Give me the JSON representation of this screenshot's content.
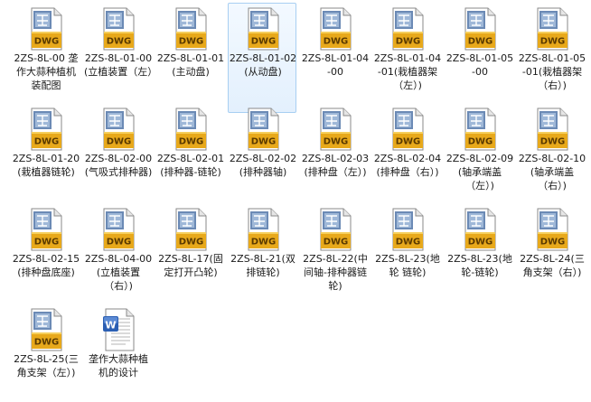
{
  "files": [
    {
      "label": "2ZS-8L-00 垄作大蒜种植机装配图",
      "type": "dwg"
    },
    {
      "label": "2ZS-8L-01-00(立植装置（左）",
      "type": "dwg"
    },
    {
      "label": "2ZS-8L-01-01(主动盘)",
      "type": "dwg"
    },
    {
      "label": "2ZS-8L-01-02(从动盘)",
      "type": "dwg",
      "selected": true
    },
    {
      "label": "2ZS-8L-01-04-00",
      "type": "dwg"
    },
    {
      "label": "2ZS-8L-01-04-01(栽植器架（左）)",
      "type": "dwg"
    },
    {
      "label": "2ZS-8L-01-05-00",
      "type": "dwg"
    },
    {
      "label": "2ZS-8L-01-05-01(栽植器架（右）)",
      "type": "dwg"
    },
    {
      "label": "2ZS-8L-01-20(栽植器链轮)",
      "type": "dwg"
    },
    {
      "label": "2ZS-8L-02-00(气吸式排种器)",
      "type": "dwg"
    },
    {
      "label": "2ZS-8L-02-01(排种器-链轮)",
      "type": "dwg"
    },
    {
      "label": "2ZS-8L-02-02(排种器轴)",
      "type": "dwg"
    },
    {
      "label": "2ZS-8L-02-03(排种盘（左）)",
      "type": "dwg"
    },
    {
      "label": "2ZS-8L-02-04(排种盘（右）)",
      "type": "dwg"
    },
    {
      "label": "2ZS-8L-02-09(轴承端盖（左）)",
      "type": "dwg"
    },
    {
      "label": "2ZS-8L-02-10(轴承端盖（右）)",
      "type": "dwg"
    },
    {
      "label": "2ZS-8L-02-15(排种盘底座)",
      "type": "dwg"
    },
    {
      "label": "2ZS-8L-04-00(立植装置（右）)",
      "type": "dwg"
    },
    {
      "label": "2ZS-8L-17(固定打开凸轮)",
      "type": "dwg"
    },
    {
      "label": "2ZS-8L-21(双排链轮)",
      "type": "dwg"
    },
    {
      "label": "2ZS-8L-22(中间轴-排种器链轮)",
      "type": "dwg"
    },
    {
      "label": "2ZS-8L-23(地轮 链轮)",
      "type": "dwg"
    },
    {
      "label": "2ZS-8L-23(地轮-链轮)",
      "type": "dwg"
    },
    {
      "label": "2ZS-8L-24(三角支架（右）)",
      "type": "dwg"
    },
    {
      "label": "2ZS-8L-25(三角支架（左）)",
      "type": "dwg"
    },
    {
      "label": "垄作大蒜种植机的设计",
      "type": "doc"
    }
  ],
  "icon_text": "DWG",
  "colors": {
    "dwg_top": "#6b8ab5",
    "dwg_badge": "#e8a91b",
    "selection_border": "#a8cff2"
  }
}
